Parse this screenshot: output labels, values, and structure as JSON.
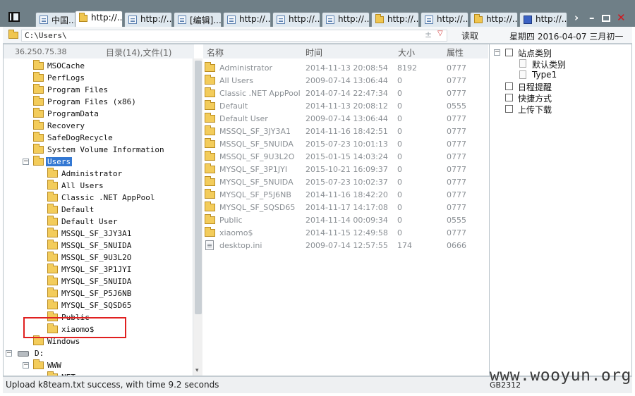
{
  "tabs": [
    {
      "label": "中国...",
      "icon": "page"
    },
    {
      "label": "http://...",
      "icon": "folder",
      "active": true
    },
    {
      "label": "http://...",
      "icon": "page"
    },
    {
      "label": "[编辑]...",
      "icon": "page"
    },
    {
      "label": "http://...",
      "icon": "page"
    },
    {
      "label": "http://...",
      "icon": "page"
    },
    {
      "label": "http://...",
      "icon": "page"
    },
    {
      "label": "http://...",
      "icon": "folder"
    },
    {
      "label": "http://...",
      "icon": "page"
    },
    {
      "label": "http://...",
      "icon": "folder"
    },
    {
      "label": "http://...",
      "icon": "film"
    }
  ],
  "address": {
    "path": "C:\\Users\\",
    "read_label": "读取",
    "date": "星期四 2016-04-07 三月初一"
  },
  "left_header": {
    "ip": "36.250.75.38",
    "count": "目录(14),文件(1)"
  },
  "tree": [
    {
      "label": "MSOCache",
      "level": 1
    },
    {
      "label": "PerfLogs",
      "level": 1
    },
    {
      "label": "Program Files",
      "level": 1
    },
    {
      "label": "Program Files (x86)",
      "level": 1
    },
    {
      "label": "ProgramData",
      "level": 1
    },
    {
      "label": "Recovery",
      "level": 1
    },
    {
      "label": "SafeDogRecycle",
      "level": 1
    },
    {
      "label": "System Volume Information",
      "level": 1
    },
    {
      "label": "Users",
      "level": 1,
      "expanded": true,
      "selected": true
    },
    {
      "label": "Administrator",
      "level": 2
    },
    {
      "label": "All Users",
      "level": 2
    },
    {
      "label": "Classic .NET AppPool",
      "level": 2
    },
    {
      "label": "Default",
      "level": 2
    },
    {
      "label": "Default User",
      "level": 2
    },
    {
      "label": "MSSQL_SF_3JY3A1",
      "level": 2
    },
    {
      "label": "MSSQL_SF_5NUIDA",
      "level": 2
    },
    {
      "label": "MSSQL_SF_9U3L2O",
      "level": 2
    },
    {
      "label": "MYSQL_SF_3P1JYI",
      "level": 2
    },
    {
      "label": "MYSQL_SF_5NUIDA",
      "level": 2
    },
    {
      "label": "MYSQL_SF_P5J6NB",
      "level": 2
    },
    {
      "label": "MYSQL_SF_SQSD65",
      "level": 2
    },
    {
      "label": "Public",
      "level": 2
    },
    {
      "label": "xiaomo$",
      "level": 2
    },
    {
      "label": "Windows",
      "level": 1
    },
    {
      "label": "D:",
      "level": 0,
      "drive": true,
      "expanded": true
    },
    {
      "label": "WWW",
      "level": 1,
      "expanded": true
    },
    {
      "label": "NET",
      "level": 2
    }
  ],
  "list_columns": {
    "name": "名称",
    "time": "时间",
    "size": "大小",
    "attr": "属性"
  },
  "files": [
    {
      "name": "Administrator",
      "time": "2014-11-13 20:08:54",
      "size": "8192",
      "attr": "0777",
      "type": "folder"
    },
    {
      "name": "All Users",
      "time": "2009-07-14 13:06:44",
      "size": "0",
      "attr": "0777",
      "type": "folder"
    },
    {
      "name": "Classic .NET AppPool",
      "time": "2014-07-14 22:47:34",
      "size": "0",
      "attr": "0777",
      "type": "folder"
    },
    {
      "name": "Default",
      "time": "2014-11-13 20:08:12",
      "size": "0",
      "attr": "0555",
      "type": "folder"
    },
    {
      "name": "Default User",
      "time": "2009-07-14 13:06:44",
      "size": "0",
      "attr": "0777",
      "type": "folder"
    },
    {
      "name": "MSSQL_SF_3JY3A1",
      "time": "2014-11-16 18:42:51",
      "size": "0",
      "attr": "0777",
      "type": "folder"
    },
    {
      "name": "MSSQL_SF_5NUIDA",
      "time": "2015-07-23 10:01:13",
      "size": "0",
      "attr": "0777",
      "type": "folder"
    },
    {
      "name": "MSSQL_SF_9U3L2O",
      "time": "2015-01-15 14:03:24",
      "size": "0",
      "attr": "0777",
      "type": "folder"
    },
    {
      "name": "MYSQL_SF_3P1JYI",
      "time": "2015-10-21 16:09:37",
      "size": "0",
      "attr": "0777",
      "type": "folder"
    },
    {
      "name": "MYSQL_SF_5NUIDA",
      "time": "2015-07-23 10:02:37",
      "size": "0",
      "attr": "0777",
      "type": "folder"
    },
    {
      "name": "MYSQL_SF_P5J6NB",
      "time": "2014-11-16 18:42:20",
      "size": "0",
      "attr": "0777",
      "type": "folder"
    },
    {
      "name": "MYSQL_SF_SQSD65",
      "time": "2014-11-17 14:17:08",
      "size": "0",
      "attr": "0777",
      "type": "folder"
    },
    {
      "name": "Public",
      "time": "2014-11-14 00:09:34",
      "size": "0",
      "attr": "0555",
      "type": "folder"
    },
    {
      "name": "xiaomo$",
      "time": "2014-11-15 12:49:58",
      "size": "0",
      "attr": "0777",
      "type": "folder"
    },
    {
      "name": "desktop.ini",
      "time": "2009-07-14 12:57:55",
      "size": "174",
      "attr": "0666",
      "type": "file"
    }
  ],
  "right_panel": [
    {
      "label": "站点类别",
      "kind": "root"
    },
    {
      "label": "默认类别",
      "kind": "child"
    },
    {
      "label": "Type1",
      "kind": "child"
    },
    {
      "label": "日程提醒",
      "kind": "item"
    },
    {
      "label": "快捷方式",
      "kind": "item"
    },
    {
      "label": "上传下载",
      "kind": "item"
    }
  ],
  "status": {
    "message": "Upload k8team.txt success, with time 9.2 seconds",
    "encoding": "GB2312"
  },
  "watermark": "www.wooyun.org",
  "colors": {
    "selection": "#3378d3",
    "highlight_box": "#e02020",
    "tabbar": "#6f7f87"
  }
}
